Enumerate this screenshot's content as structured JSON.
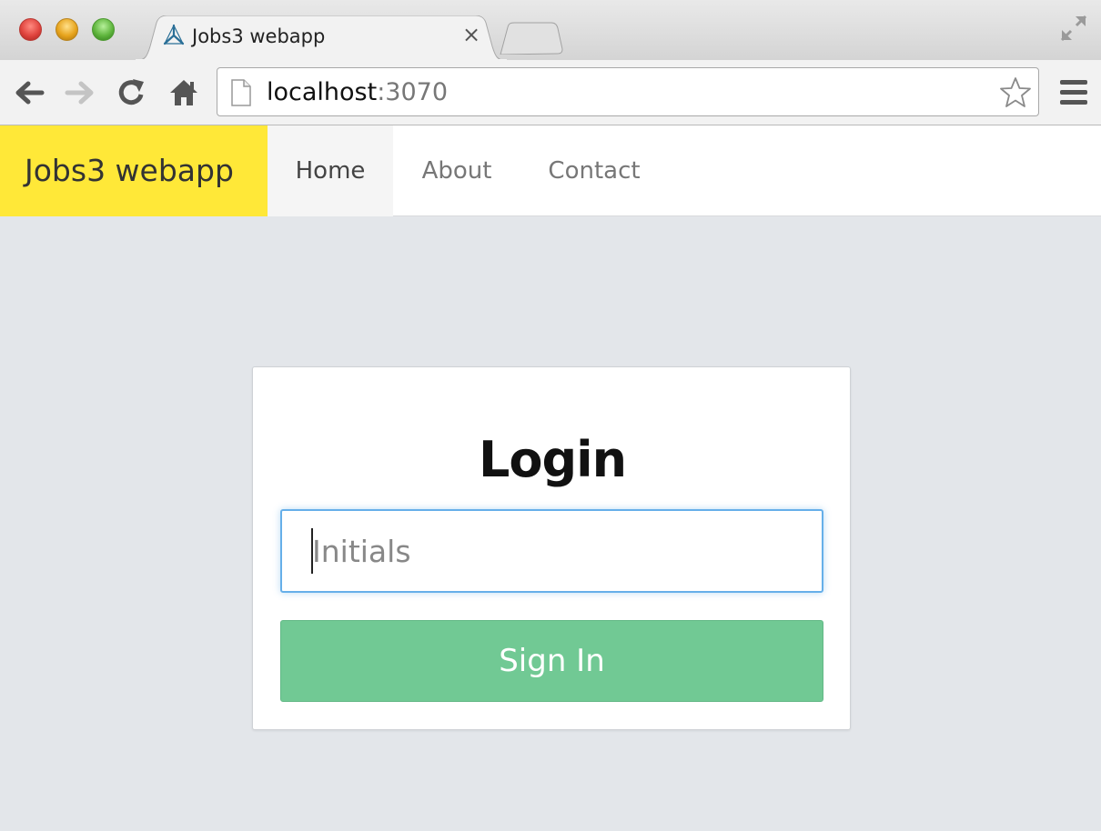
{
  "browser": {
    "tab": {
      "title": "Jobs3 webapp",
      "close_glyph": "×",
      "favicon": "triangle-logo-icon"
    },
    "address_bar": {
      "host": "localhost",
      "port": ":3070"
    },
    "icons": [
      "back-arrow-icon",
      "forward-arrow-icon",
      "reload-icon",
      "home-icon",
      "page-icon",
      "star-icon",
      "menu-icon",
      "fullscreen-icon"
    ]
  },
  "navbar": {
    "brand": "Jobs3 webapp",
    "items": [
      {
        "label": "Home",
        "active": true
      },
      {
        "label": "About",
        "active": false
      },
      {
        "label": "Contact",
        "active": false
      }
    ]
  },
  "login": {
    "title": "Login",
    "initials_placeholder": "Initials",
    "initials_value": "",
    "submit_label": "Sign In"
  },
  "colors": {
    "brand_bg": "#ffe838",
    "page_bg": "#e3e6ea",
    "button": "#71c994",
    "input_focus": "#66afe9"
  }
}
